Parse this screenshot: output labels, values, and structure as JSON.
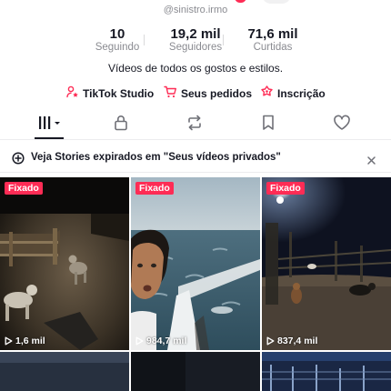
{
  "profile": {
    "handle": "@sinistro.irmo"
  },
  "stats": [
    {
      "value": "10",
      "label": "Seguindo"
    },
    {
      "value": "19,2 mil",
      "label": "Seguidores"
    },
    {
      "value": "71,6 mil",
      "label": "Curtidas"
    }
  ],
  "bio": "Vídeos de todos os gostos e estilos.",
  "links": {
    "studio": "TikTok Studio",
    "orders": "Seus pedidos",
    "subscription": "Inscrição"
  },
  "tabs": [
    {
      "icon": "grid-icon",
      "active": true
    },
    {
      "icon": "lock-icon",
      "active": false
    },
    {
      "icon": "repost-icon",
      "active": false
    },
    {
      "icon": "bookmark-icon",
      "active": false
    },
    {
      "icon": "heart-icon",
      "active": false
    }
  ],
  "banner": {
    "text": "Veja Stories expirados em \"Seus vídeos privados\""
  },
  "videos": [
    {
      "badge": "Fixado",
      "views": "1,6 mil"
    },
    {
      "badge": "Fixado",
      "views": "984,7 mil"
    },
    {
      "badge": "Fixado",
      "views": "837,4 mil"
    }
  ],
  "colors": {
    "accent": "#fe2c55",
    "text": "#161823",
    "muted": "#8a8b91"
  }
}
